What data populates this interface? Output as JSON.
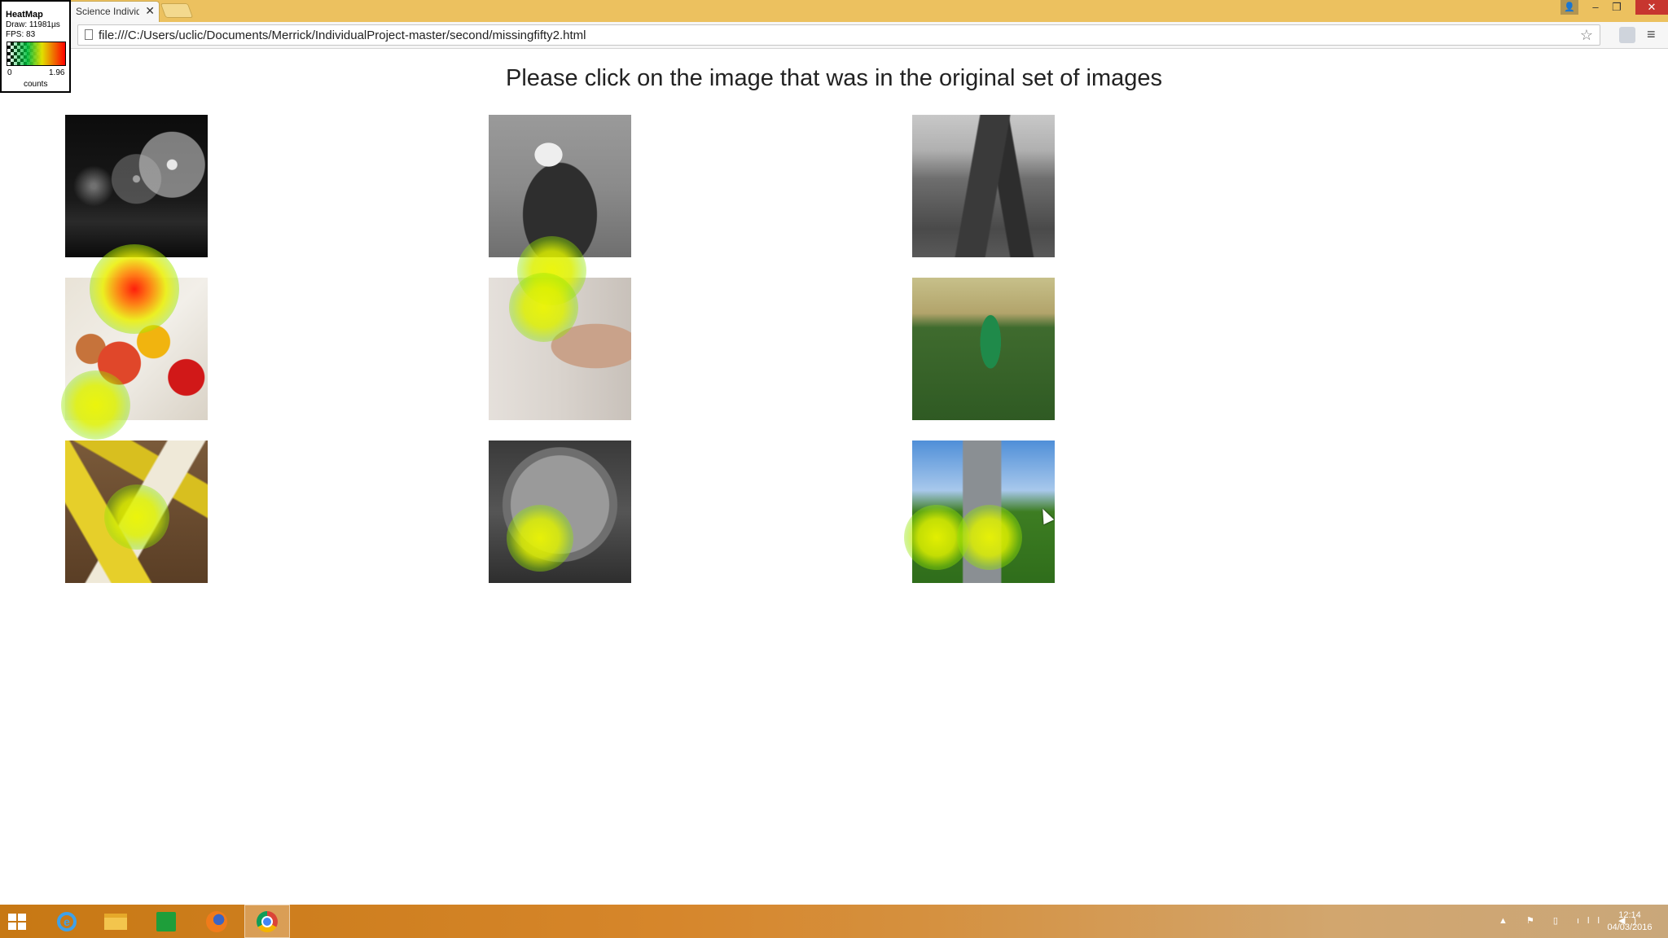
{
  "browser": {
    "tab_title": "Science Individu",
    "tab_close": "✕",
    "url": "file:///C:/Users/uclic/Documents/Merrick/IndividualProject-master/second/missingfifty2.html",
    "window_controls": {
      "user": "👤",
      "minimize": "–",
      "restore": "❐",
      "close": "✕"
    },
    "star": "☆",
    "menu": "≡"
  },
  "heatmap_widget": {
    "title": "HeatMap",
    "draw": "Draw: 11981µs",
    "fps": "FPS: 83",
    "scale_min": "0",
    "scale_max": "1.96",
    "scale_label": "counts"
  },
  "page": {
    "heading": "Please click on the image that was in the original set of images",
    "images": [
      {
        "name": "fireworks-image",
        "subject": "fireworks over city at night (grayscale)"
      },
      {
        "name": "eagle-image",
        "subject": "bald eagle (grayscale)"
      },
      {
        "name": "sea-rocks-image",
        "subject": "sea stacks on coast (grayscale)"
      },
      {
        "name": "vegetables-image",
        "subject": "peppers and vegetables (color)"
      },
      {
        "name": "hand-cable-image",
        "subject": "hand holding coiled cable (color)"
      },
      {
        "name": "football-boy-image",
        "subject": "boy kicking football (color)"
      },
      {
        "name": "measuring-tape-image",
        "subject": "measuring tape (color)"
      },
      {
        "name": "pizza-image",
        "subject": "pizza slices (grayscale)"
      },
      {
        "name": "park-stairs-image",
        "subject": "park with stairs and lamps (color)"
      }
    ]
  },
  "taskbar": {
    "apps": [
      "internet-explorer",
      "file-explorer",
      "store",
      "firefox",
      "chrome"
    ],
    "active_app": "chrome",
    "tray": "▲ ⚑ ▯ ıll ◀)",
    "time": "12:14",
    "date": "04/03/2016"
  },
  "colors": {
    "titlebar": "#ecc15f",
    "heat_low": "#e6f000",
    "heat_high": "#ff1400",
    "window_close": "#c7362f"
  }
}
